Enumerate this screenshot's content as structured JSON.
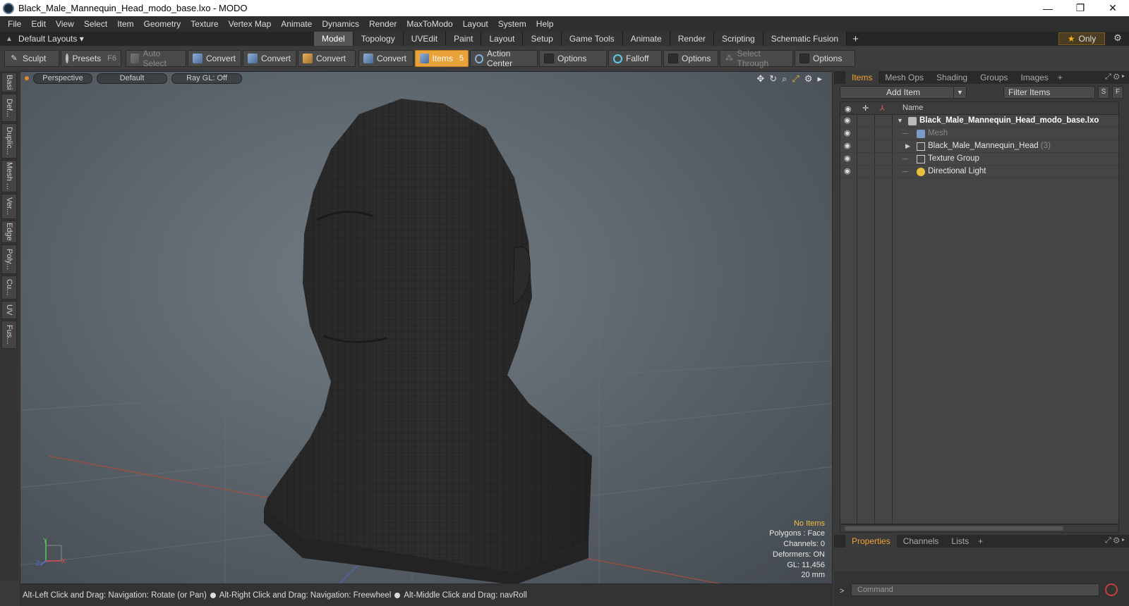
{
  "window": {
    "title": "Black_Male_Mannequin_Head_modo_base.lxo - MODO",
    "minimize": "—",
    "restore": "❐",
    "close": "✕"
  },
  "menu": [
    "File",
    "Edit",
    "View",
    "Select",
    "Item",
    "Geometry",
    "Texture",
    "Vertex Map",
    "Animate",
    "Dynamics",
    "Render",
    "MaxToModo",
    "Layout",
    "System",
    "Help"
  ],
  "layoutbar": {
    "layouts_label": "Default Layouts ▾",
    "tabs": [
      "Model",
      "Topology",
      "UVEdit",
      "Paint",
      "Layout",
      "Setup",
      "Game Tools",
      "Animate",
      "Render",
      "Scripting",
      "Schematic Fusion"
    ],
    "active_tab": "Model",
    "add_tab": "+",
    "only_label": "Only",
    "star": "★"
  },
  "toolbar": {
    "sculpt": "Sculpt",
    "presets": "Presets",
    "presets_key": "F6",
    "auto_select": "Auto Select",
    "convert": "Convert",
    "items": "Items",
    "items_key": "5",
    "action_center": "Action Center",
    "options": "Options",
    "falloff": "Falloff",
    "select_through": "Select Through"
  },
  "left_tabs": [
    "Basi",
    "Def...",
    "Duplic...",
    "Mesh ...",
    "Ver...",
    "Edge",
    "Poly...",
    "Cu...",
    "UV",
    "Fus..."
  ],
  "viewport": {
    "view_mode": "Perspective",
    "shading": "Default",
    "raygl": "Ray GL: Off",
    "stats": {
      "selection": "No Items",
      "polygons": "Polygons : Face",
      "channels": "Channels: 0",
      "deformers": "Deformers: ON",
      "gl": "GL: 11,456",
      "scale": "20 mm"
    },
    "axis": {
      "x": "X",
      "y": "Y",
      "z": "Z"
    }
  },
  "statusbar": {
    "hint1": "Alt-Left Click and Drag: Navigation: Rotate (or Pan)",
    "hint2": "Alt-Right Click and Drag: Navigation: Freewheel",
    "hint3": "Alt-Middle Click and Drag: navRoll"
  },
  "items_panel": {
    "tabs": [
      "Items",
      "Mesh Ops",
      "Shading",
      "Groups",
      "Images"
    ],
    "active_tab": "Items",
    "add_item": "Add Item",
    "filter_placeholder": "Filter Items",
    "s_btn": "S",
    "f_btn": "F",
    "column_name": "Name",
    "tree": [
      {
        "label": "Black_Male_Mannequin_Head_modo_base.lxo",
        "level": 0,
        "kind": "scene",
        "expanded": true
      },
      {
        "label": "Mesh",
        "level": 1,
        "kind": "mesh",
        "dim": true
      },
      {
        "label": "Black_Male_Mannequin_Head",
        "count": "(3)",
        "level": 1,
        "kind": "group",
        "collapsed": true
      },
      {
        "label": "Texture Group",
        "level": 1,
        "kind": "group"
      },
      {
        "label": "Directional Light",
        "level": 1,
        "kind": "light"
      }
    ]
  },
  "properties_panel": {
    "tabs": [
      "Properties",
      "Channels",
      "Lists"
    ],
    "active_tab": "Properties"
  },
  "command": {
    "prompt": ">",
    "placeholder": "Command"
  },
  "colors": {
    "accent": "#e8a238",
    "active_tab_text": "#f0a030",
    "mesh": "#2a2a2a"
  }
}
